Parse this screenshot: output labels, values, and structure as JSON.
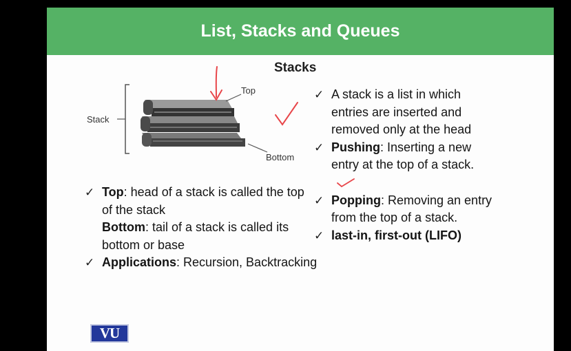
{
  "slide": {
    "title": "List, Stacks and Queues",
    "subtitle": "Stacks",
    "logo_text": "VU"
  },
  "diagram": {
    "stack_label": "Stack",
    "top_label": "Top",
    "bottom_label": "Bottom"
  },
  "left_bullets": [
    {
      "term": "Top",
      "text": ": head of a stack is called the top of the stack"
    },
    {
      "term": "Bottom",
      "text": ": tail of a stack is called its bottom or base"
    },
    {
      "term": "Applications",
      "text": ": Recursion, Backtracking"
    }
  ],
  "right_bullets": [
    {
      "term": "",
      "text": "A stack is a list in which entries are inserted and removed only at the head"
    },
    {
      "term": "Pushing",
      "text": ": Inserting a new entry at the top of a stack."
    },
    {
      "term": "Popping",
      "text": ": Removing an entry from the top of a stack."
    },
    {
      "term": "last-in, first-out (LIFO)",
      "text": ""
    }
  ],
  "colors": {
    "title_bar": "#55b265",
    "annotation_ink": "#e8464a",
    "logo_bg": "#23389b"
  }
}
